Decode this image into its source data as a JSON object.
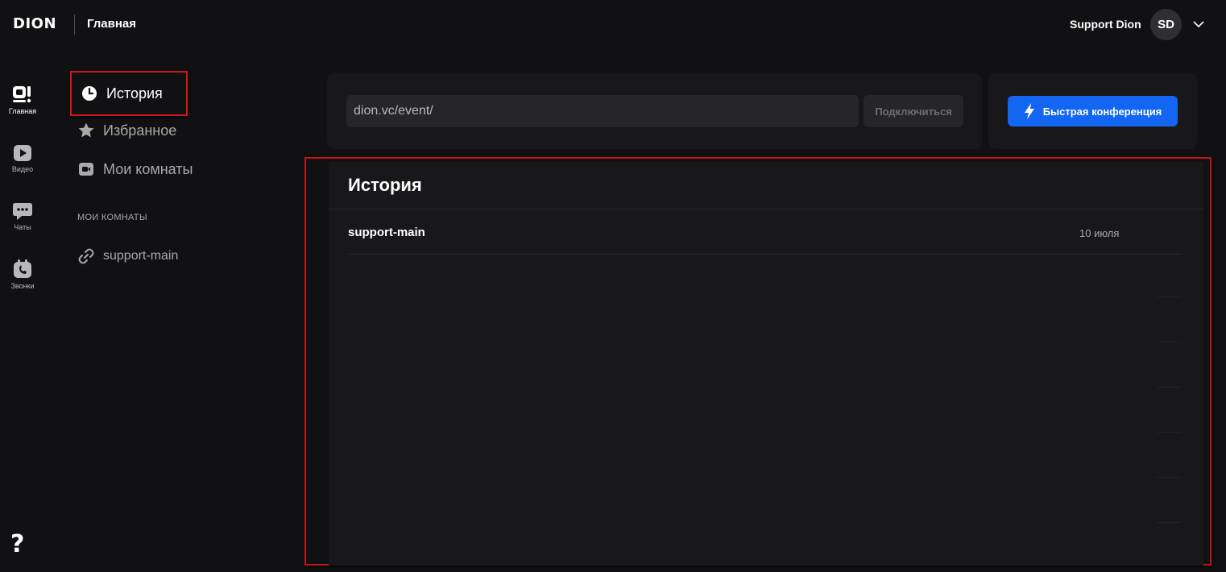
{
  "header": {
    "logo": "DION",
    "title": "Главная",
    "user_name": "Support Dion",
    "avatar_initials": "SD"
  },
  "rail": {
    "items": [
      {
        "label": "Главная",
        "icon": "home-icon",
        "active": true
      },
      {
        "label": "Видео",
        "icon": "video-play-icon"
      },
      {
        "label": "Чаты",
        "icon": "chat-icon"
      },
      {
        "label": "Звонки",
        "icon": "phone-calendar-icon"
      }
    ],
    "help": "?"
  },
  "nav": {
    "items": [
      {
        "label": "История",
        "icon": "clock-icon",
        "active": true
      },
      {
        "label": "Избранное",
        "icon": "star-icon"
      },
      {
        "label": "Мои комнаты",
        "icon": "camera-icon"
      }
    ],
    "section_label": "МОИ КОМНАТЫ",
    "rooms": [
      {
        "label": "support-main",
        "icon": "link-icon"
      }
    ]
  },
  "join": {
    "input_value": "dion.vc/event/",
    "connect_label": "Подключиться"
  },
  "quick": {
    "label": "Быстрая конференция",
    "icon": "lightning-icon"
  },
  "history": {
    "title": "История",
    "rows": [
      {
        "name": "support-main",
        "date": "10 июля"
      }
    ]
  },
  "colors": {
    "background": "#111113",
    "card": "#18181b",
    "accent": "#1266f1",
    "highlight_border": "#c1141a"
  }
}
